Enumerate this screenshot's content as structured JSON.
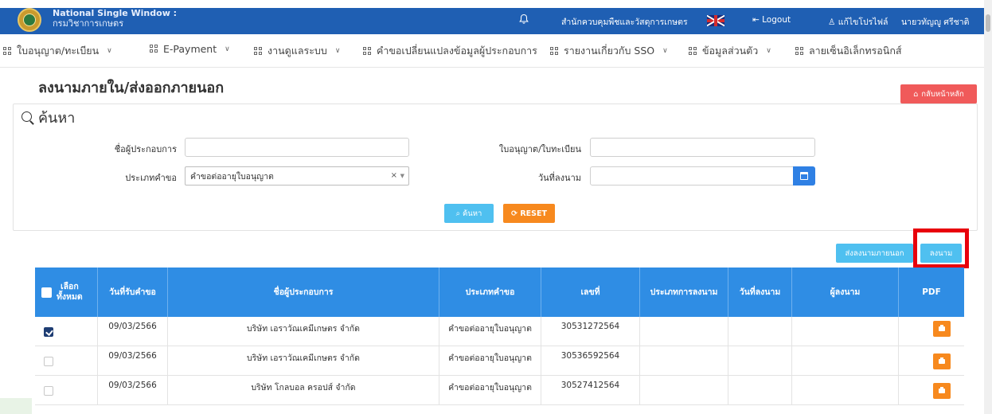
{
  "header": {
    "brand_line1": "National Single Window :",
    "brand_line2": "กรมวิชาการเกษตร",
    "office": "สำนักควบคุมพืชและวัสดุการเกษตร",
    "logout": "Logout",
    "profile": "แก้ไขโปรไฟล์",
    "user": "นายวทัญญู ศรีชาติ",
    "bg_color": "#1f5fb3"
  },
  "nav": {
    "items": [
      {
        "label": "ใบอนุญาต/ทะเบียน",
        "has_dropdown": true
      },
      {
        "label": "E-Payment",
        "has_dropdown": true
      },
      {
        "label": "งานดูแลระบบ",
        "has_dropdown": true
      },
      {
        "label": "คำขอเปลี่ยนแปลงข้อมูลผู้ประกอบการ",
        "has_dropdown": false
      },
      {
        "label": "รายงานเกี่ยวกับ SSO",
        "has_dropdown": true
      },
      {
        "label": "ข้อมูลส่วนตัว",
        "has_dropdown": true
      },
      {
        "label": "ลายเซ็นอิเล็กทรอนิกส์",
        "has_dropdown": false
      }
    ]
  },
  "page": {
    "title": "ลงนามภายใน/ส่งออกภายนอก",
    "home_button": "กลับหน้าหลัก"
  },
  "search": {
    "heading": "ค้นหา",
    "operator_label": "ชื่อผู้ประกอบการ",
    "operator_value": "",
    "license_label": "ใบอนุญาต/ใบทะเบียน",
    "license_value": "",
    "request_type_label": "ประเภทคำขอ",
    "request_type_value": "คำขอต่ออายุใบอนุญาต",
    "sign_date_label": "วันที่ลงนาม",
    "sign_date_value": "",
    "search_button": "ค้นหา",
    "reset_button": "RESET"
  },
  "actions": {
    "send_external": "ส่งลงนามภายนอก",
    "sign": "ลงนาม"
  },
  "table": {
    "columns": [
      "เลือก ทั้งหมด",
      "วันที่รับคำขอ",
      "ชื่อผู้ประกอบการ",
      "ประเภทคำขอ",
      "เลขที่",
      "ประเภทการลงนาม",
      "วันที่ลงนาม",
      "ผู้ลงนาม",
      "PDF"
    ],
    "select_all_l1": "เลือก",
    "select_all_l2": "ทั้งหมด",
    "rows": [
      {
        "checked": true,
        "date": "09/03/2566",
        "operator": "บริษัท เอราวัณเคมีเกษตร จำกัด",
        "type": "คำขอต่ออายุใบอนุญาต",
        "number": "30531272564",
        "sign_type": "",
        "sign_date": "",
        "signer": ""
      },
      {
        "checked": false,
        "date": "09/03/2566",
        "operator": "บริษัท เอราวัณเคมีเกษตร จำกัด",
        "type": "คำขอต่ออายุใบอนุญาต",
        "number": "30536592564",
        "sign_type": "",
        "sign_date": "",
        "signer": ""
      },
      {
        "checked": false,
        "date": "09/03/2566",
        "operator": "บริษัท โกลบอล ครอปส์ จำกัด",
        "type": "คำขอต่ออายุใบอนุญาต",
        "number": "30527412564",
        "sign_type": "",
        "sign_date": "",
        "signer": ""
      }
    ]
  }
}
